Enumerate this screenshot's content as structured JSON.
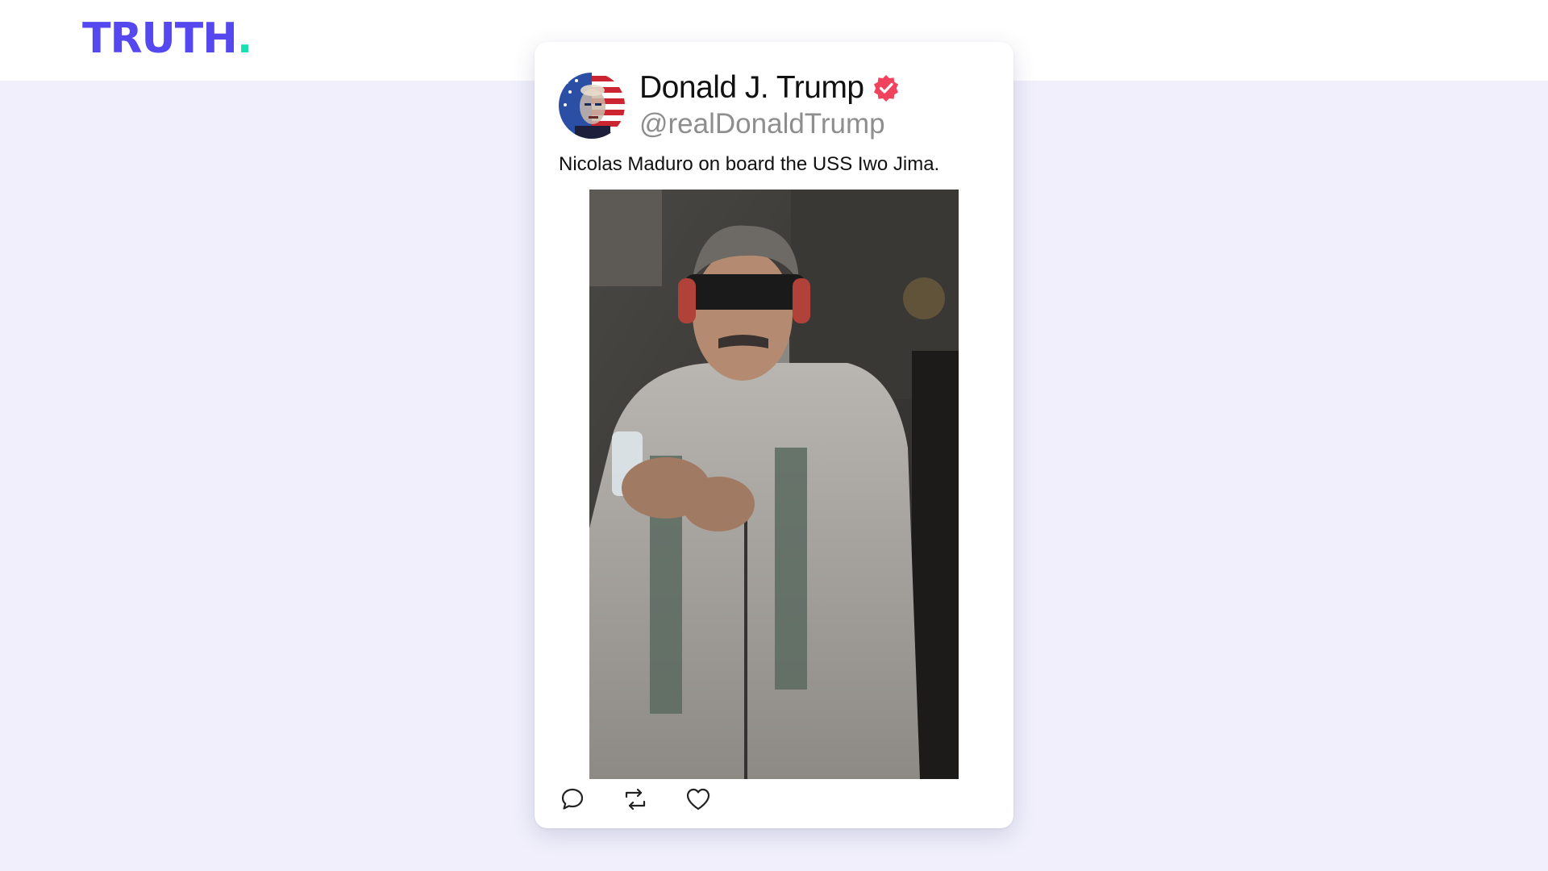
{
  "brand": {
    "logo_text": "TRUTH",
    "logo_dot": ".",
    "colors": {
      "brand": "#5448ee",
      "accent": "#17e0b4"
    }
  },
  "post": {
    "display_name": "Donald J. Trump",
    "handle": "@realDonaldTrump",
    "verified": true,
    "verified_color": "#f0445e",
    "text": "Nicolas Maduro on board the USS Iwo Jima.",
    "avatar_icon": "avatar-flag-portrait",
    "media_icon": "photo-attachment"
  },
  "actions": [
    {
      "name": "reply",
      "icon": "reply-icon"
    },
    {
      "name": "retruth",
      "icon": "retruth-icon"
    },
    {
      "name": "like",
      "icon": "heart-icon"
    }
  ]
}
